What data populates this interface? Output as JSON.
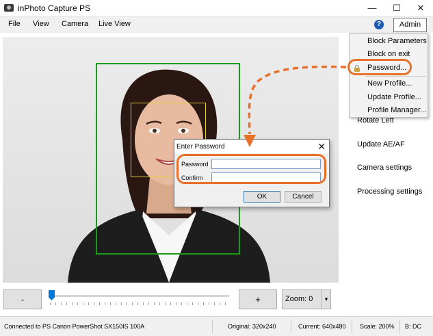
{
  "window": {
    "title": "inPhoto Capture PS",
    "minimize": "—",
    "maximize": "☐",
    "close": "✕"
  },
  "menu": {
    "items": [
      "File",
      "View",
      "Camera",
      "Live View"
    ],
    "help": "?",
    "admin": "Admin"
  },
  "admin_menu": {
    "items": [
      "Block Parameters",
      "Block on exit",
      "Password...",
      "New Profile...",
      "Update Profile...",
      "Profile Manager..."
    ],
    "highlighted": "Password..."
  },
  "right_panel": {
    "items": [
      "Rotate Left",
      "Update AE/AF",
      "Camera settings",
      "Processing settings"
    ]
  },
  "dialog": {
    "title": "Enter Password",
    "close": "✕",
    "password_label": "Password",
    "password_value": "",
    "confirm_label": "Confirm",
    "confirm_value": "",
    "ok_label": "OK",
    "cancel_label": "Cancel"
  },
  "controls": {
    "minus_label": "-",
    "plus_label": "+",
    "zoom_label": "Zoom: 0",
    "zoom_arrow": "▾",
    "zoom_slider_value": 0
  },
  "status": {
    "connection": "Connected to PS Canon PowerShot SX150IS 100A",
    "original": "Original: 320x240",
    "current": "Current: 640x480",
    "scale": "Scale: 200%",
    "extra": "B: DC"
  },
  "colors": {
    "accent": "#e8702a",
    "face_frame": "#1b9a1b",
    "eye_frame": "#e2d23a",
    "slider": "#0078d7"
  }
}
